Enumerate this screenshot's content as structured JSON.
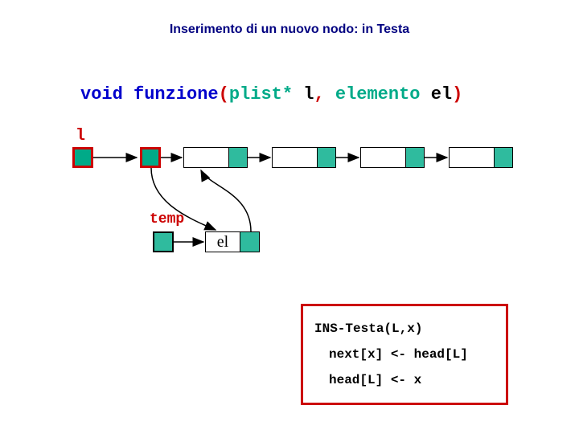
{
  "title": "Inserimento di un nuovo nodo: in Testa",
  "signature": {
    "kw": "void",
    "fn": "funzione",
    "lp": "(",
    "ty1": "plist*",
    "arg1": "l",
    "comma": ",",
    "ty2": "elemento",
    "arg2": "el",
    "rp": ")"
  },
  "labels": {
    "l": "l",
    "temp": "temp",
    "el": "el"
  },
  "pseudo": {
    "line1": "INS-Testa(L,x)",
    "line2": "next[x] <- head[L]",
    "line3": "head[L] <- x"
  }
}
